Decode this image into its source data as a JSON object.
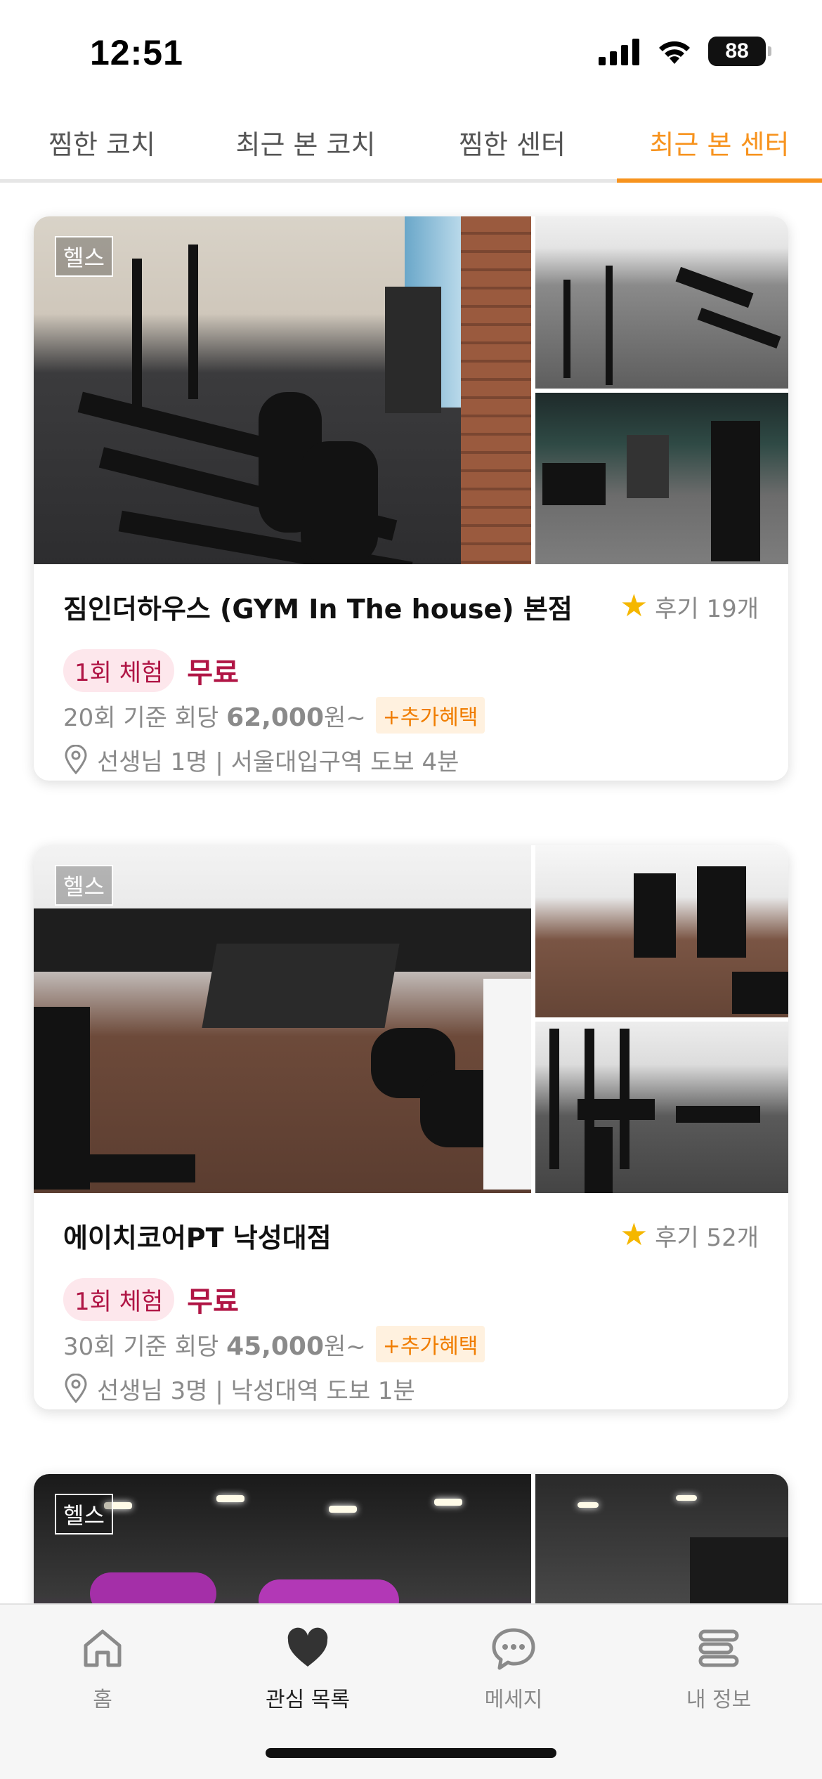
{
  "status_bar": {
    "time": "12:51",
    "battery": "88"
  },
  "tabs": [
    {
      "label": "찜한 코치",
      "active": false
    },
    {
      "label": "최근 본 코치",
      "active": false
    },
    {
      "label": "찜한 센터",
      "active": false
    },
    {
      "label": "최근 본 센터",
      "active": true
    }
  ],
  "cards": [
    {
      "category": "헬스",
      "name": "짐인더하우스 (GYM In The house) 본점",
      "review": "후기 19개",
      "trial": "1회 체험",
      "trial_price": "무료",
      "price_prefix": "20회 기준 회당",
      "price": "62,000",
      "price_suffix": "원~",
      "benefit": "+추가혜택",
      "location": "선생님 1명 | 서울대입구역 도보 4분"
    },
    {
      "category": "헬스",
      "name": "에이치코어PT 낙성대점",
      "review": "후기 52개",
      "trial": "1회 체험",
      "trial_price": "무료",
      "price_prefix": "30회 기준 회당",
      "price": "45,000",
      "price_suffix": "원~",
      "benefit": "+추가혜택",
      "location": "선생님 3명 | 낙성대역 도보 1분"
    },
    {
      "category": "헬스"
    }
  ],
  "bottom_nav": [
    {
      "label": "홈",
      "icon": "home-icon"
    },
    {
      "label": "관심 목록",
      "icon": "heart-icon",
      "active": true
    },
    {
      "label": "메세지",
      "icon": "chat-icon"
    },
    {
      "label": "내 정보",
      "icon": "menu-icon"
    }
  ],
  "colors": {
    "accent": "#f7931e",
    "trial": "#b01545",
    "star": "#f5b700"
  }
}
